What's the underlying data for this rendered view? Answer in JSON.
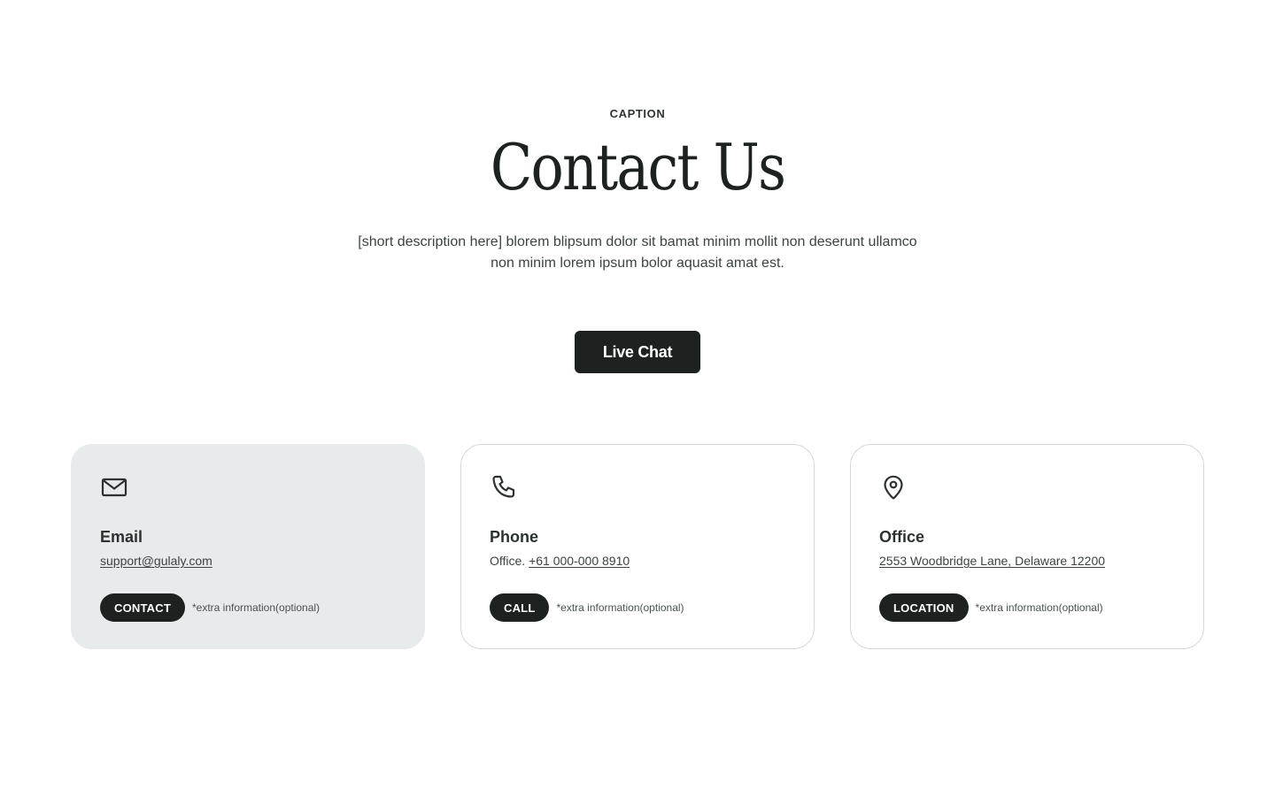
{
  "header": {
    "caption": "CAPTION",
    "title": "Contact Us",
    "description": "[short description here] blorem blipsum dolor sit bamat minim mollit non deserunt ullamco non minim lorem ipsum bolor aquasit amat est.",
    "live_chat_label": "Live Chat"
  },
  "cards": {
    "email": {
      "icon": "mail-icon",
      "heading": "Email",
      "link": "support@gulaly.com",
      "button_label": "CONTACT",
      "extra": "*extra information(optional)",
      "highlighted": true
    },
    "phone": {
      "icon": "phone-icon",
      "heading": "Phone",
      "prefix": "Office. ",
      "link": "+61 000-000 8910",
      "button_label": "CALL",
      "extra": "*extra information(optional)"
    },
    "office": {
      "icon": "map-pin-icon",
      "heading": "Office",
      "link": "2553 Woodbridge Lane, Delaware 12200",
      "button_label": "LOCATION",
      "extra": "*extra information(optional)"
    }
  },
  "colors": {
    "primary": "#1d2120",
    "card_highlight": "#e7ebeb",
    "card_border": "#d5d9d8",
    "background": "#ffffff"
  }
}
